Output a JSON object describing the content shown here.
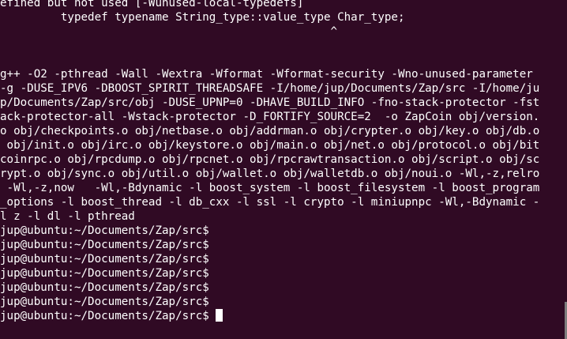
{
  "terminal": {
    "lines": [
      "efined but not used [-Wunused-local-typedefs]",
      "         typedef typename String_type::value_type Char_type;",
      "                                                 ^",
      "",
      "",
      "g++ -O2 -pthread -Wall -Wextra -Wformat -Wformat-security -Wno-unused-parameter",
      "-g -DUSE_IPV6 -DBOOST_SPIRIT_THREADSAFE -I/home/jup/Documents/Zap/src -I/home/ju",
      "p/Documents/Zap/src/obj -DUSE_UPNP=0 -DHAVE_BUILD_INFO -fno-stack-protector -fst",
      "ack-protector-all -Wstack-protector -D_FORTIFY_SOURCE=2  -o ZapCoin obj/version.",
      "o obj/checkpoints.o obj/netbase.o obj/addrman.o obj/crypter.o obj/key.o obj/db.o",
      " obj/init.o obj/irc.o obj/keystore.o obj/main.o obj/net.o obj/protocol.o obj/bit",
      "coinrpc.o obj/rpcdump.o obj/rpcnet.o obj/rpcrawtransaction.o obj/script.o obj/sc",
      "rypt.o obj/sync.o obj/util.o obj/wallet.o obj/walletdb.o obj/noui.o -Wl,-z,relro",
      " -Wl,-z,now   -Wl,-Bdynamic -l boost_system -l boost_filesystem -l boost_program",
      "_options -l boost_thread -l db_cxx -l ssl -l crypto -l miniupnpc -Wl,-Bdynamic -",
      "l z -l dl -l pthread"
    ],
    "prompt": "jup@ubuntu:~/Documents/Zap/src$",
    "prompt_count": 7,
    "colors": {
      "background": "#300a24",
      "foreground": "#ffffff",
      "scrollbar": "#7e7e7e"
    }
  }
}
